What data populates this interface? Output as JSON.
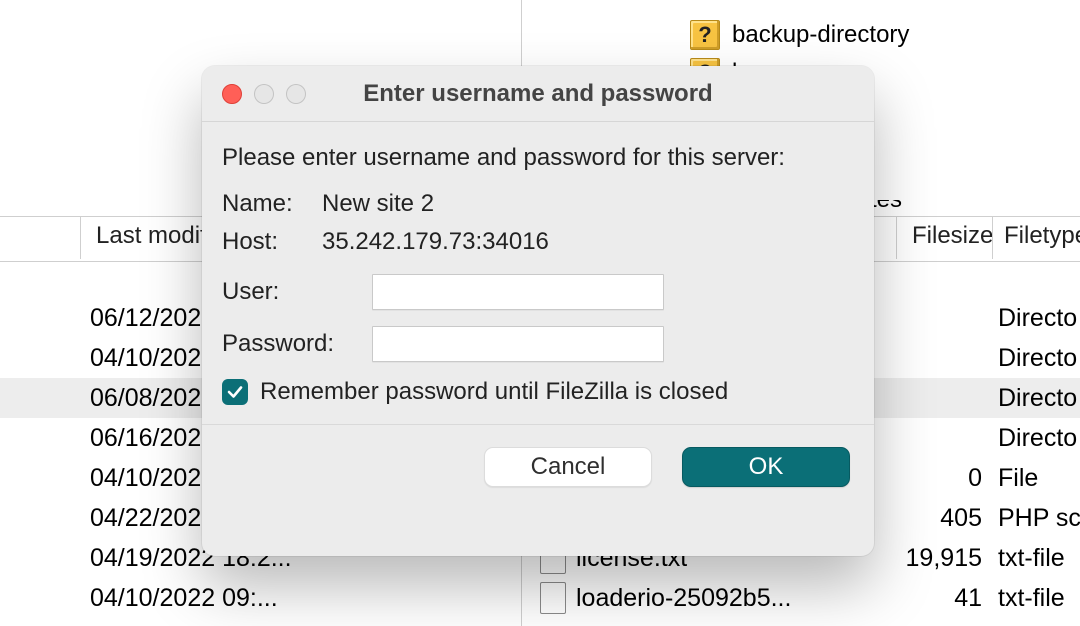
{
  "background": {
    "top_files": [
      {
        "name": "backup-directory"
      },
      {
        "name": "logs"
      }
    ],
    "column_headers": {
      "last_modified": "Last modifi",
      "filesize": "Filesize",
      "filetype": "Filetype"
    },
    "right_clipped_text": "tes",
    "rows": [
      {
        "date": "06/12/202",
        "filesize": "",
        "filetype": "Directo",
        "filename": ""
      },
      {
        "date": "04/10/202",
        "filesize": "",
        "filetype": "Directo",
        "filename": ""
      },
      {
        "date": "06/08/202",
        "filesize": "",
        "filetype": "Directo",
        "filename": "",
        "selected": true
      },
      {
        "date": "06/16/202",
        "filesize": "",
        "filetype": "Directo",
        "filename": ""
      },
      {
        "date": "04/10/202",
        "filesize": "0",
        "filetype": "File",
        "filename": ""
      },
      {
        "date": "04/22/202",
        "filesize": "405",
        "filetype": "PHP sc",
        "filename": ""
      },
      {
        "date": "04/19/2022 18:2...",
        "filesize": "19,915",
        "filetype": "txt-file",
        "filename": "license.txt"
      },
      {
        "date": "04/10/2022 09:...",
        "filesize": "41",
        "filetype": "txt-file",
        "filename": "loaderio-25092b5..."
      }
    ]
  },
  "dialog": {
    "title": "Enter username and password",
    "prompt": "Please enter username and password for this server:",
    "name_label": "Name:",
    "name_value": "New site 2",
    "host_label": "Host:",
    "host_value": "35.242.179.73:34016",
    "user_label": "User:",
    "user_value": "",
    "password_label": "Password:",
    "password_value": "",
    "remember_label": "Remember password until FileZilla is closed",
    "remember_checked": true,
    "cancel_label": "Cancel",
    "ok_label": "OK"
  }
}
